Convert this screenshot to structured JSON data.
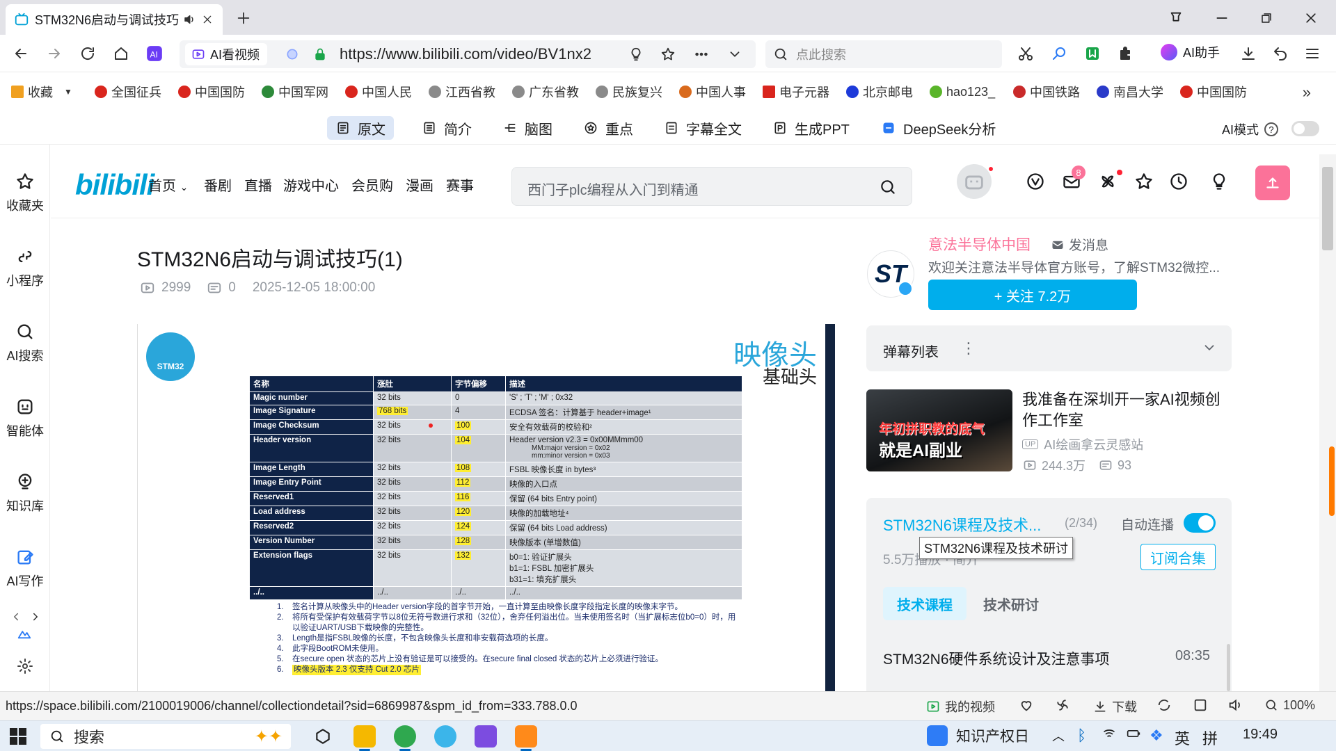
{
  "browser": {
    "tab_title": "STM32N6启动与调试技巧",
    "url": "https://www.bilibili.com/video/BV1nx2",
    "ai_view_label": "AI看视频",
    "search_placeholder": "点此搜索",
    "ai_helper_label": "AI助手",
    "bookmarks_more": "»"
  },
  "bookmarks": [
    {
      "label": "收藏",
      "color": "#f0a020"
    },
    {
      "label": "全国征兵",
      "color": "#d9251d"
    },
    {
      "label": "中国国防",
      "color": "#d9251d"
    },
    {
      "label": "中国军网",
      "color": "#2d8a3a"
    },
    {
      "label": "中国人民",
      "color": "#d9251d"
    },
    {
      "label": "江西省教",
      "color": "#8a8a8a"
    },
    {
      "label": "广东省教",
      "color": "#8a8a8a"
    },
    {
      "label": "民族复兴",
      "color": "#8a8a8a"
    },
    {
      "label": "中国人事",
      "color": "#d96a1d"
    },
    {
      "label": "电子元器",
      "color": "#d9251d"
    },
    {
      "label": "北京邮电",
      "color": "#1d3ad9"
    },
    {
      "label": "hao123_",
      "color": "#5ab52a"
    },
    {
      "label": "中国铁路",
      "color": "#c92a2a"
    },
    {
      "label": "南昌大学",
      "color": "#2a3ac9"
    },
    {
      "label": "中国国防",
      "color": "#d9251d"
    }
  ],
  "ai_toolbar": {
    "items": [
      "原文",
      "简介",
      "脑图",
      "重点",
      "字幕全文",
      "生成PPT",
      "DeepSeek分析"
    ],
    "mode_label": "AI模式",
    "help": "?"
  },
  "sidebar": [
    "收藏夹",
    "小程序",
    "AI搜索",
    "智能体",
    "知识库",
    "AI写作"
  ],
  "bilibili_header": {
    "logo": "bilibili",
    "nav": [
      "首页",
      "番剧",
      "直播",
      "游戏中心",
      "会员购",
      "漫画",
      "赛事"
    ],
    "search_placeholder": "西门子plc编程从入门到精通",
    "message_badge": "8"
  },
  "video": {
    "title": "STM32N6启动与调试技巧(1)",
    "views": "2999",
    "danmaku": "0",
    "date": "2025-12-05 18:00:00"
  },
  "slide": {
    "logo_text": "STM32",
    "heading": "映像头",
    "subheading": "基础头",
    "headers": [
      "名称",
      "涨肚",
      "字节偏移",
      "描述"
    ],
    "rows": [
      [
        "Magic number",
        "32 bits",
        "0",
        "'S' ; 'T' ; 'M' ; 0x32"
      ],
      [
        "Image Signature",
        "768 bits",
        "4",
        "ECDSA 签名：计算基于 header+image¹"
      ],
      [
        "Image Checksum",
        "32 bits",
        "100",
        "安全有效载荷的校验和²"
      ],
      [
        "Header version",
        "32 bits",
        "104",
        "Header version v2.3 = 0x00MMmm00"
      ],
      [
        "Image Length",
        "32 bits",
        "108",
        "FSBL 映像长度 in bytes³"
      ],
      [
        "Image Entry  Point",
        "32 bits",
        "112",
        "映像的入口点"
      ],
      [
        "Reserved1",
        "32 bits",
        "116",
        "保留 (64 bits Entry point)"
      ],
      [
        "Load address",
        "32 bits",
        "120",
        "映像的加载地址⁴"
      ],
      [
        "Reserved2",
        "32 bits",
        "124",
        "保留 (64 bits Load address)"
      ],
      [
        "Version Number",
        "32 bits",
        "128",
        "映像版本 (单增数值)"
      ],
      [
        "Extension flags",
        "32 bits",
        "132",
        "b0=1: 验证扩展头"
      ],
      [
        "../..",
        "../..",
        "../..",
        "../.."
      ]
    ],
    "header_version_sub1": "MM:major version = 0x02",
    "header_version_sub2": "mm:minor version = 0x03",
    "ext_flags_2": "b1=1: FSBL 加密扩展头",
    "ext_flags_3": "b31=1: 填充扩展头",
    "notes": [
      "签名计算从映像头中的Header version字段的首字节开始，一直计算至由映像长度字段指定长度的映像末字节。",
      "将所有受保护有效载荷字节以8位无符号数进行求和（32位），舍弃任何溢出位。当未使用签名时（当扩展标志位b0=0）时，用以验证UART/USB下载映像的完整性。",
      "Length是指FSBL映像的长度，不包含映像头长度和非安载荷选项的长度。",
      "此字段BootROM未使用。",
      "在secure open 状态的芯片上没有验证是可以接受的。在secure final closed 状态的芯片上必须进行验证。",
      "映像头版本 2.3 仅支持 Cut 2.0 芯片"
    ]
  },
  "uploader": {
    "logo": "ST",
    "name": "意法半导体中国",
    "message": "发消息",
    "desc": "欢迎关注意法半导体官方账号，了解STM32微控...",
    "follow": "+ 关注 7.2万"
  },
  "danmaku_list": {
    "label": "弹幕列表",
    "more": "⋮"
  },
  "recommend": {
    "thumb_line1": "年初拼职教的底气",
    "thumb_line2": "就是AI副业",
    "title": "我准备在深圳开一家AI视频创作工作室",
    "up_tag": "UP",
    "uploader": "AI绘画拿云灵感站",
    "views": "244.3万",
    "comments": "93"
  },
  "collection": {
    "title": "STM32N6课程及技术...",
    "count": "(2/34)",
    "autoplay_label": "自动连播",
    "tooltip": "STM32N6课程及技术研讨",
    "stats": "5.5万播放 · 简介",
    "subscribe": "订阅合集",
    "tabs": [
      "技术课程",
      "技术研讨"
    ],
    "episode_title": "STM32N6硬件系统设计及注意事项",
    "episode_duration": "08:35"
  },
  "statusbar": {
    "url": "https://space.bilibili.com/2100019006/channel/collectiondetail?sid=6869987&spm_id_from=333.788.0.0",
    "my_video": "我的视频",
    "download": "下载",
    "zoom": "100%"
  },
  "taskbar": {
    "search": "搜索",
    "kip_label": "知识产权日",
    "ime": "英",
    "ime2": "拼",
    "time": "19:49"
  }
}
